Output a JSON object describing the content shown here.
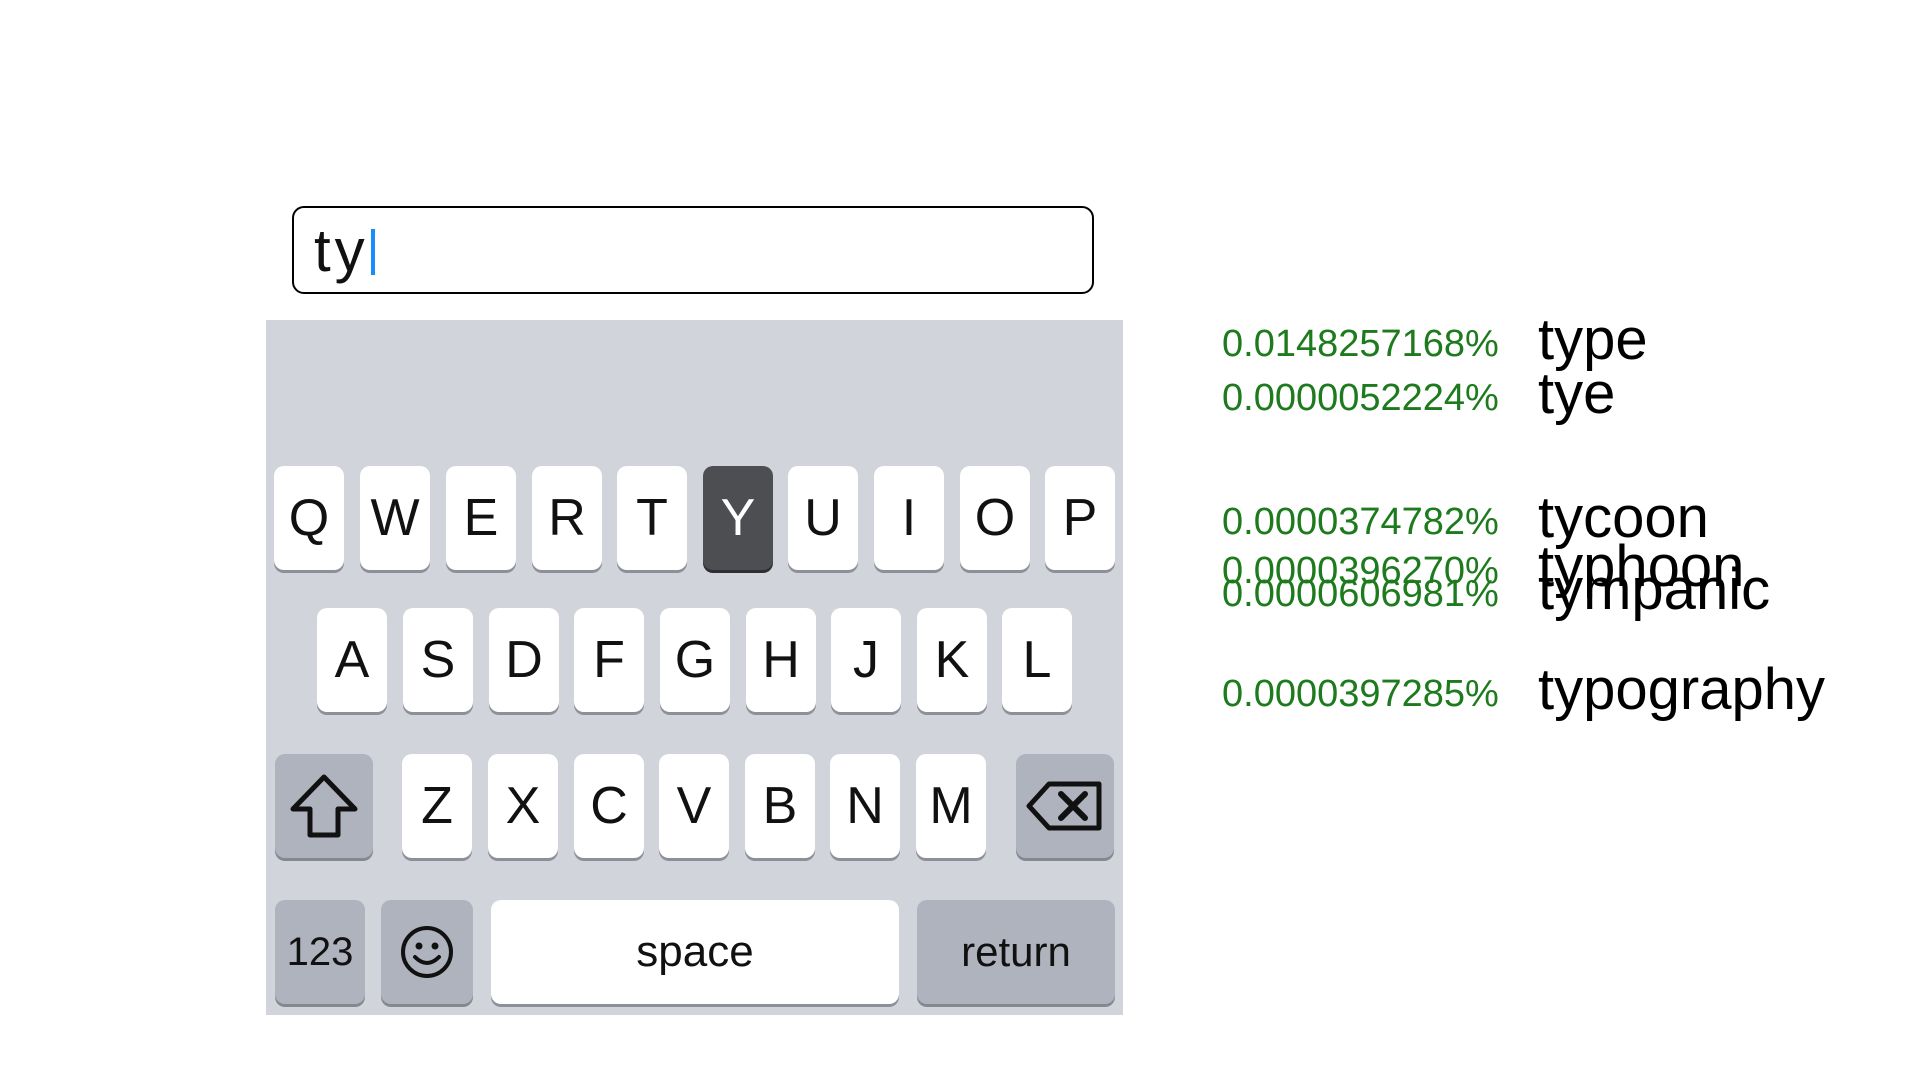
{
  "input": {
    "value": "ty"
  },
  "keyboard": {
    "row1": [
      "Q",
      "W",
      "E",
      "R",
      "T",
      "Y",
      "U",
      "I",
      "O",
      "P"
    ],
    "row2": [
      "A",
      "S",
      "D",
      "F",
      "G",
      "H",
      "J",
      "K",
      "L"
    ],
    "row3": [
      "Z",
      "X",
      "C",
      "V",
      "B",
      "N",
      "M"
    ],
    "pressed_key": "Y",
    "numbers_label": "123",
    "space_label": "space",
    "return_label": "return",
    "icons": {
      "shift": "shift-arrow-icon",
      "delete": "backspace-icon",
      "emoji": "smiley-icon"
    }
  },
  "predictions": [
    {
      "percent": "0.0148257168%",
      "word": "type"
    },
    {
      "percent": "0.0000052224%",
      "word": "tye"
    },
    {
      "percent": "0.0000374782%",
      "word": "tycoon"
    },
    {
      "percent": "0.0000396270%",
      "word": "typhoon"
    },
    {
      "percent": "0.0000606981%",
      "word": "tympanic"
    },
    {
      "percent": "0.0000397285%",
      "word": "typography"
    }
  ],
  "colors": {
    "percent_text": "#1d7a1d",
    "caret": "#1a8cff",
    "keyboard_bg": "#d1d4db",
    "pressed_key": "#4c4e52"
  }
}
